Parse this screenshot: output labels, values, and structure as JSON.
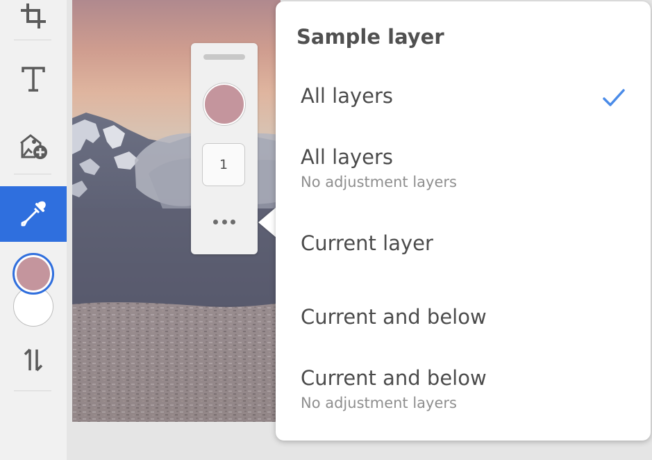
{
  "toolbar": {
    "tools": [
      {
        "icon": "crop-icon",
        "active": false
      },
      {
        "icon": "type-icon",
        "active": false
      },
      {
        "icon": "place-image-icon",
        "active": false
      },
      {
        "icon": "eyedropper-icon",
        "active": true
      }
    ],
    "foreground_color": "#c4959d",
    "background_color": "#ffffff",
    "swap_icon": "swap-arrows-icon",
    "accent_color": "#2f6fde"
  },
  "tool_panel": {
    "sample_color": "#c4959d",
    "sample_size": "1",
    "more_icon": "more-horizontal-icon"
  },
  "popover": {
    "title": "Sample layer",
    "options": [
      {
        "label": "All layers",
        "sublabel": "",
        "selected": true
      },
      {
        "label": "All layers",
        "sublabel": "No adjustment layers",
        "selected": false
      },
      {
        "label": "Current layer",
        "sublabel": "",
        "selected": false
      },
      {
        "label": "Current and below",
        "sublabel": "",
        "selected": false
      },
      {
        "label": "Current and below",
        "sublabel": "No adjustment layers",
        "selected": false
      }
    ],
    "check_icon": "checkmark-icon",
    "check_color": "#4a8be8"
  }
}
